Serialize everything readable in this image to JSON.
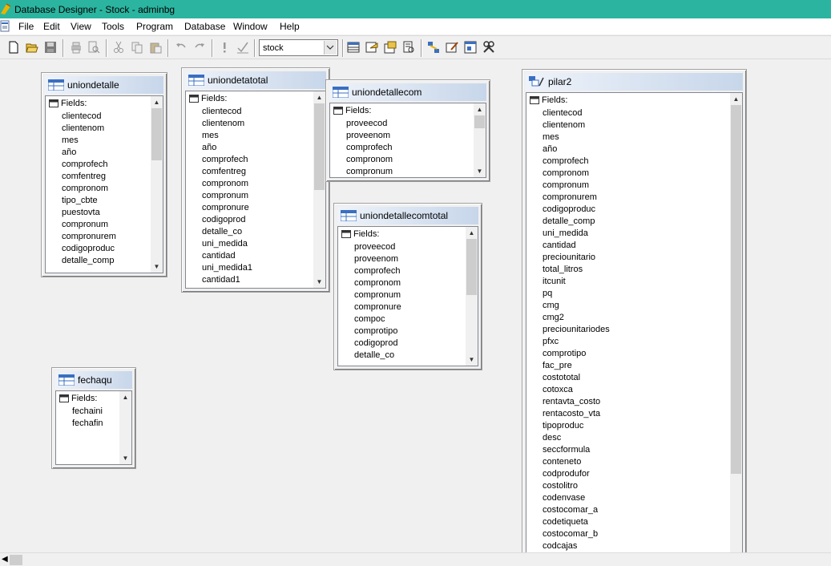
{
  "window": {
    "title": "Database Designer - Stock - adminbg"
  },
  "menu": [
    "File",
    "Edit",
    "View",
    "Tools",
    "Program",
    "Database",
    "Window",
    "Help"
  ],
  "toolbar": {
    "database_select": {
      "value": "stock"
    },
    "icons": [
      "new-icon",
      "open-icon",
      "save-icon",
      "print-icon",
      "print-preview-icon",
      "cut-icon",
      "copy-icon",
      "paste-icon",
      "undo-icon",
      "redo-icon",
      "run-icon",
      "check-icon",
      "browse-table-icon",
      "modify-table-icon",
      "properties-icon",
      "view-code-icon",
      "relations-icon",
      "edit-icon",
      "form-icon",
      "tools-icon"
    ]
  },
  "tables": [
    {
      "name": "uniondetalle",
      "fields_label": "Fields:",
      "fields": [
        "clientecod",
        "clientenom",
        "mes",
        "año",
        "comprofech",
        "comfentreg",
        "compronom",
        "tipo_cbte",
        "puestovta",
        "compronum",
        "compronurem",
        "codigoproduc",
        "detalle_comp"
      ]
    },
    {
      "name": "uniondetatotal",
      "fields_label": "Fields:",
      "fields": [
        "clientecod",
        "clientenom",
        "mes",
        "año",
        "comprofech",
        "comfentreg",
        "compronom",
        "compronum",
        "compronure",
        "codigoprod",
        "detalle_co",
        "uni_medida",
        "cantidad",
        "uni_medida1",
        "cantidad1"
      ]
    },
    {
      "name": "uniondetallecom",
      "fields_label": "Fields:",
      "fields": [
        "proveecod",
        "proveenom",
        "comprofech",
        "compronom",
        "compronum"
      ]
    },
    {
      "name": "uniondetallecomtotal",
      "fields_label": "Fields:",
      "fields": [
        "proveecod",
        "proveenom",
        "comprofech",
        "compronom",
        "compronum",
        "compronure",
        "compoc",
        "comprotipo",
        "codigoprod",
        "detalle_co"
      ]
    },
    {
      "name": "fechaqu",
      "fields_label": "Fields:",
      "fields": [
        "fechaini",
        "fechafin"
      ]
    },
    {
      "name": "pilar2",
      "fields_label": "Fields:",
      "fields": [
        "clientecod",
        "clientenom",
        "mes",
        "año",
        "comprofech",
        "compronom",
        "compronum",
        "compronurem",
        "codigoproduc",
        "detalle_comp",
        "uni_medida",
        "cantidad",
        "preciounitario",
        "total_litros",
        "itcunit",
        "pq",
        "cmg",
        "cmg2",
        "preciounitariodes",
        "pfxc",
        "comprotipo",
        "fac_pre",
        "costototal",
        "cotoxca",
        "rentavta_costo",
        "rentacosto_vta",
        "tipoproduc",
        "desc",
        "seccformula",
        "conteneto",
        "codprodufor",
        "costolitro",
        "codenvase",
        "costocomar_a",
        "codetiqueta",
        "costocomar_b",
        "codcajas"
      ]
    }
  ]
}
